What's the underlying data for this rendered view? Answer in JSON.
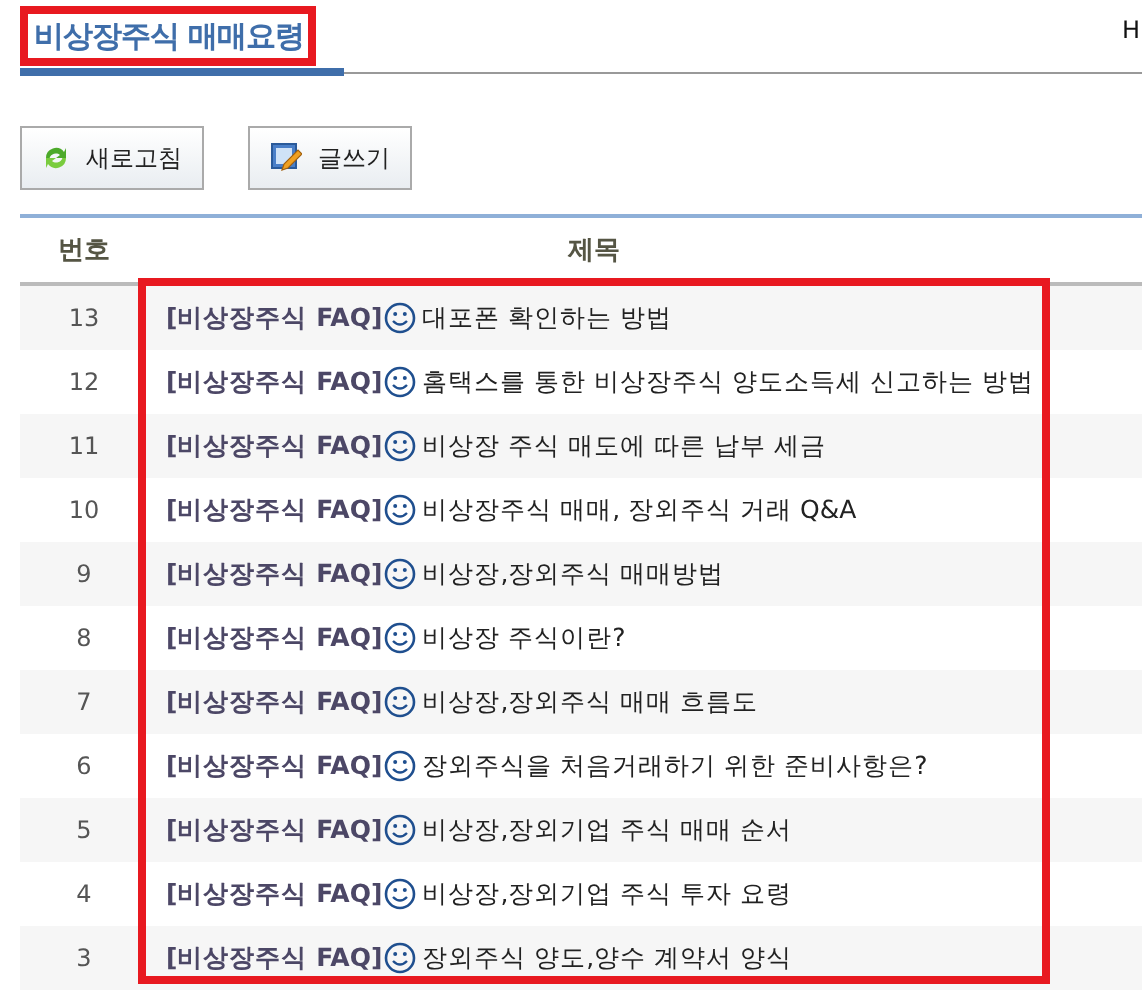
{
  "page_title": "비상장주식 매매요령",
  "cut_text": "H",
  "buttons": [
    {
      "kind": "refresh",
      "label": "새로고침"
    },
    {
      "kind": "write",
      "label": "글쓰기"
    }
  ],
  "table": {
    "columns": [
      "번호",
      "제목"
    ],
    "rows": [
      {
        "number": "13",
        "prefix": "[비상장주식 FAQ]",
        "title": "대포폰 확인하는 방법"
      },
      {
        "number": "12",
        "prefix": "[비상장주식 FAQ]",
        "title": "홈택스를 통한 비상장주식 양도소득세 신고하는 방법"
      },
      {
        "number": "11",
        "prefix": "[비상장주식 FAQ]",
        "title": "비상장 주식 매도에 따른 납부 세금"
      },
      {
        "number": "10",
        "prefix": "[비상장주식 FAQ]",
        "title": "비상장주식 매매, 장외주식 거래 Q&A"
      },
      {
        "number": "9",
        "prefix": "[비상장주식 FAQ]",
        "title": "비상장,장외주식 매매방법"
      },
      {
        "number": "8",
        "prefix": "[비상장주식 FAQ]",
        "title": "비상장 주식이란?"
      },
      {
        "number": "7",
        "prefix": "[비상장주식 FAQ]",
        "title": "비상장,장외주식 매매 흐름도"
      },
      {
        "number": "6",
        "prefix": "[비상장주식 FAQ]",
        "title": "장외주식을 처음거래하기 위한 준비사항은?"
      },
      {
        "number": "5",
        "prefix": "[비상장주식 FAQ]",
        "title": "비상장,장외기업 주식 매매 순서"
      },
      {
        "number": "4",
        "prefix": "[비상장주식 FAQ]",
        "title": "비상장,장외기업 주식 투자 요령"
      },
      {
        "number": "3",
        "prefix": "[비상장주식 FAQ]",
        "title": "장외주식 양도,양수 계약서 양식"
      }
    ]
  }
}
